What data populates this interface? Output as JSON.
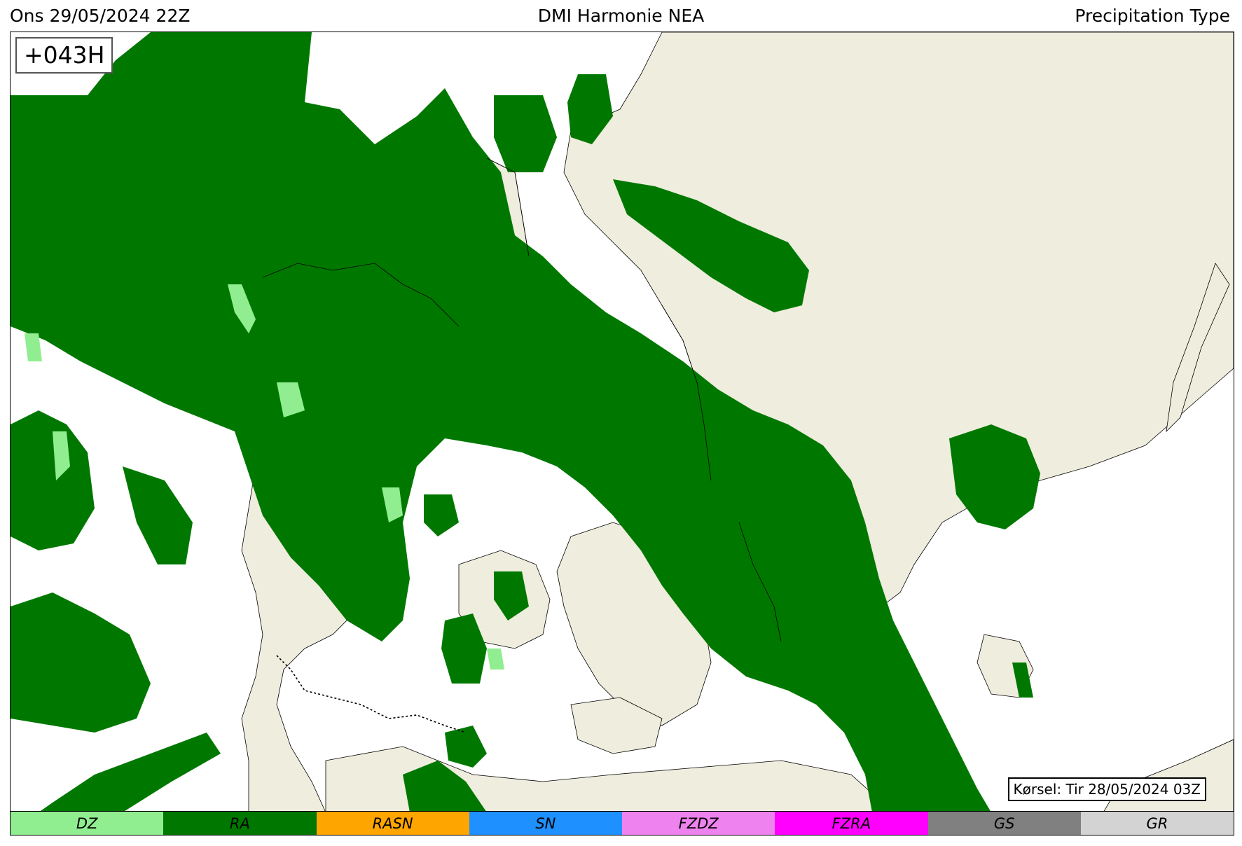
{
  "header": {
    "left": "Ons 29/05/2024 22Z",
    "center": "DMI Harmonie NEA",
    "right": "Precipitation Type"
  },
  "map": {
    "lead_time": "+043H",
    "run_label": "Kørsel: Tir 28/05/2024 03Z",
    "land_color": "#efedde",
    "sea_color": "#ffffff",
    "coastline_color": "#000000",
    "border_style": "dotted"
  },
  "legend": [
    {
      "code": "DZ",
      "color": "#90ee90"
    },
    {
      "code": "RA",
      "color": "#007800"
    },
    {
      "code": "RASN",
      "color": "#ffa500"
    },
    {
      "code": "SN",
      "color": "#1e90ff"
    },
    {
      "code": "FZDZ",
      "color": "#ee82ee"
    },
    {
      "code": "FZRA",
      "color": "#ff00ff"
    },
    {
      "code": "GS",
      "color": "#808080"
    },
    {
      "code": "GR",
      "color": "#d3d3d3"
    }
  ]
}
